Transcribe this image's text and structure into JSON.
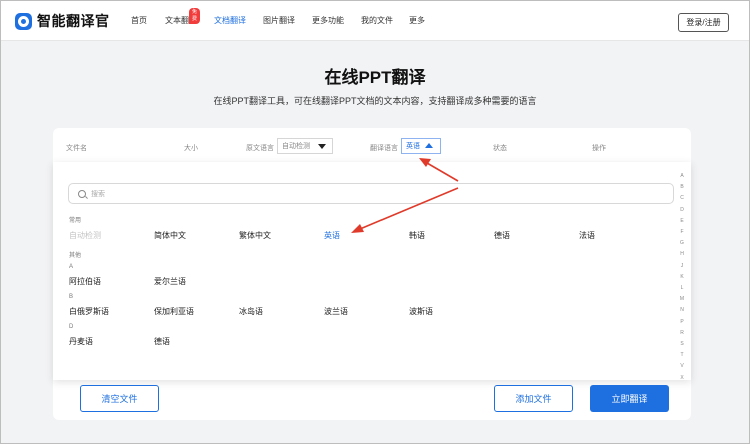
{
  "app": {
    "title": "智能翻译官"
  },
  "nav": {
    "items": [
      {
        "label": "首页",
        "active": false
      },
      {
        "label": "文本翻译",
        "active": false
      },
      {
        "label": "文档翻译",
        "active": true
      },
      {
        "label": "图片翻译",
        "active": false
      },
      {
        "label": "更多功能",
        "active": false
      },
      {
        "label": "我的文件",
        "active": false
      },
      {
        "label": "更多",
        "active": false
      }
    ],
    "badge": "免费",
    "login_label": "登录/注册"
  },
  "hero": {
    "title": "在线PPT翻译",
    "subtitle": "在线PPT翻译工具，可在线翻译PPT文档的文本内容，支持翻译成多种需要的语言"
  },
  "table": {
    "headers": {
      "filename": "文件名",
      "size": "大小",
      "source_lang": "原文语言",
      "target_lang": "翻译语言",
      "status": "状态",
      "action": "操作"
    },
    "source_value": "自动检测",
    "target_value": "英语"
  },
  "dropdown": {
    "search_placeholder": "搜索",
    "common_label": "常用",
    "common": [
      "自动检测",
      "简体中文",
      "繁体中文",
      "英语",
      "韩语",
      "德语",
      "法语"
    ],
    "other_label": "其他",
    "groups": [
      {
        "letter": "A",
        "items": [
          "阿拉伯语",
          "爱尔兰语"
        ]
      },
      {
        "letter": "B",
        "items": [
          "白俄罗斯语",
          "保加利亚语",
          "冰岛语",
          "波兰语",
          "波斯语"
        ]
      },
      {
        "letter": "D",
        "items": [
          "丹麦语",
          "德语"
        ]
      }
    ],
    "alphabet": [
      "A",
      "B",
      "C",
      "D",
      "E",
      "F",
      "G",
      "H",
      "J",
      "K",
      "L",
      "M",
      "N",
      "P",
      "R",
      "S",
      "T",
      "V",
      "X"
    ]
  },
  "buttons": {
    "clear": "清空文件",
    "add": "添加文件",
    "translate": "立即翻译"
  },
  "colors": {
    "accent": "#1e6fe0",
    "annotation_arrow": "#e03a2a",
    "badge": "#f23c3c"
  }
}
